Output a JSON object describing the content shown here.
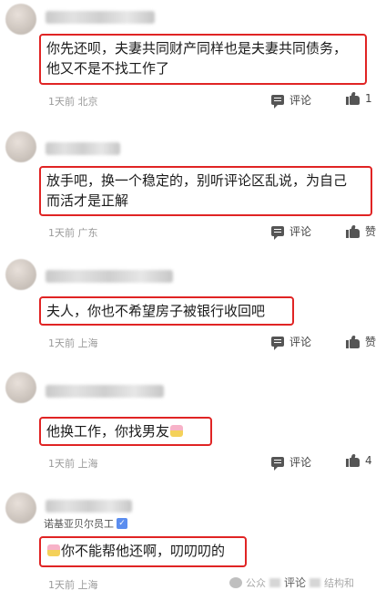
{
  "comments": [
    {
      "text_lines": [
        "你先还呗，夫妻共同财产同样也是夫妻共同债务，",
        "他又不是不找工作了"
      ],
      "time": "1天前",
      "location": "北京",
      "reply_label": "评论",
      "like_label": "1"
    },
    {
      "text_lines": [
        "放手吧，换一个稳定的，别听评论区乱说，为自己",
        "而活才是正解"
      ],
      "time": "1天前",
      "location": "广东",
      "reply_label": "评论",
      "like_label": "赞"
    },
    {
      "text_lines": [
        "夫人，你也不希望房子被银行收回吧"
      ],
      "time": "1天前",
      "location": "上海",
      "reply_label": "评论",
      "like_label": "赞"
    },
    {
      "text_lines": [
        "他换工作，你找男友"
      ],
      "time": "1天前",
      "location": "上海",
      "reply_label": "评论",
      "like_label": "4"
    },
    {
      "subtag": "诺基亚贝尔员工",
      "text_lines": [
        "你不能帮他还啊，叨叨叨的"
      ],
      "time": "1天前",
      "location": "上海",
      "reply_label": "评论",
      "like_label": ""
    }
  ],
  "watermark": {
    "prefix": "公众",
    "suffix": "结构和"
  },
  "icons": {
    "reply": "comment-bubble-icon",
    "like": "thumbs-up-icon",
    "verified": "verified-badge-icon",
    "emoji": "emoji-icon",
    "watermark": "wechat-icon"
  }
}
